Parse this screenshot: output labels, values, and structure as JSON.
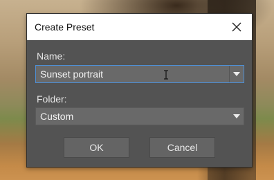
{
  "dialog": {
    "title": "Create Preset",
    "close_icon": "close-icon",
    "name_label": "Name:",
    "name_value": "Sunset portrait",
    "folder_label": "Folder:",
    "folder_value": "Custom",
    "ok_label": "OK",
    "cancel_label": "Cancel"
  },
  "colors": {
    "dialog_background": "#535353",
    "field_background": "#696969",
    "focus_border": "#4d8fd6",
    "button_background": "#646464"
  }
}
